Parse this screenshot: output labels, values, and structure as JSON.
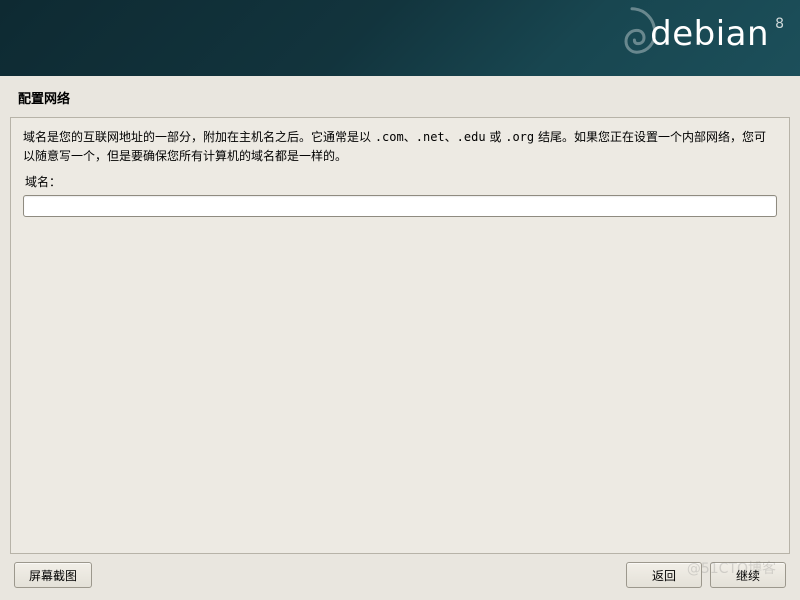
{
  "header": {
    "brand_wordmark": "debian",
    "brand_version": "8",
    "swirl_icon": "debian-swirl-icon"
  },
  "title": "配置网络",
  "body": {
    "description_prefix": "域名是您的互联网地址的一部分，附加在主机名之后。它通常是以 ",
    "ext_com": ".com",
    "sep1": "、",
    "ext_net": ".net",
    "sep2": "、",
    "ext_edu": ".edu",
    "sep3": " 或 ",
    "ext_org": ".org",
    "description_suffix": " 结尾。如果您正在设置一个内部网络，您可以随意写一个，但是要确保您所有计算机的域名都是一样的。",
    "field_label": "域名：",
    "domain_value": "",
    "domain_placeholder": ""
  },
  "buttons": {
    "screenshot": "屏幕截图",
    "back": "返回",
    "continue": "继续"
  },
  "watermark": "@51CTO博客"
}
